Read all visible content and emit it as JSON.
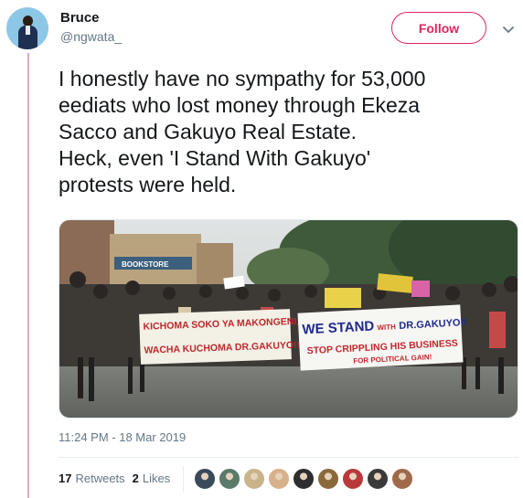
{
  "tweet": {
    "user": {
      "name": "Bruce",
      "handle": "@ngwata_"
    },
    "follow_label": "Follow",
    "text_lines": [
      "I honestly have no sympathy for 53,000",
      "eediats who lost money through Ekeza",
      "Sacco and Gakuyo Real Estate.",
      "Heck, even 'I Stand With Gakuyo'",
      "protests were held."
    ],
    "timestamp": "11:24 PM - 18 Mar 2019",
    "retweets": {
      "count": "17",
      "label": "Retweets"
    },
    "likes": {
      "count": "2",
      "label": "Likes"
    }
  },
  "photo": {
    "banner_left": {
      "line1": "KICHOMA SOKO YA MAKONGENI,",
      "line2": "WACHA KUCHOMA DR.GAKUYO!!"
    },
    "banner_right": {
      "line1": "WE STAND",
      "with": "WITH",
      "name": "DR.GAKUYO!!",
      "line2": "STOP CRIPPLING HIS BUSINESS",
      "line3": "FOR POLITICAL GAIN!"
    },
    "shop_sign": "BOOKSTORE"
  },
  "liker_colors": [
    "#3b4a5a",
    "#5a7a6a",
    "#c9b38a",
    "#d9b08c",
    "#2e2e2e",
    "#8a6a3a",
    "#b83a3a",
    "#3a3a3a",
    "#a06a4a"
  ],
  "colors": {
    "accent": "#e0245e",
    "muted": "#657786"
  }
}
